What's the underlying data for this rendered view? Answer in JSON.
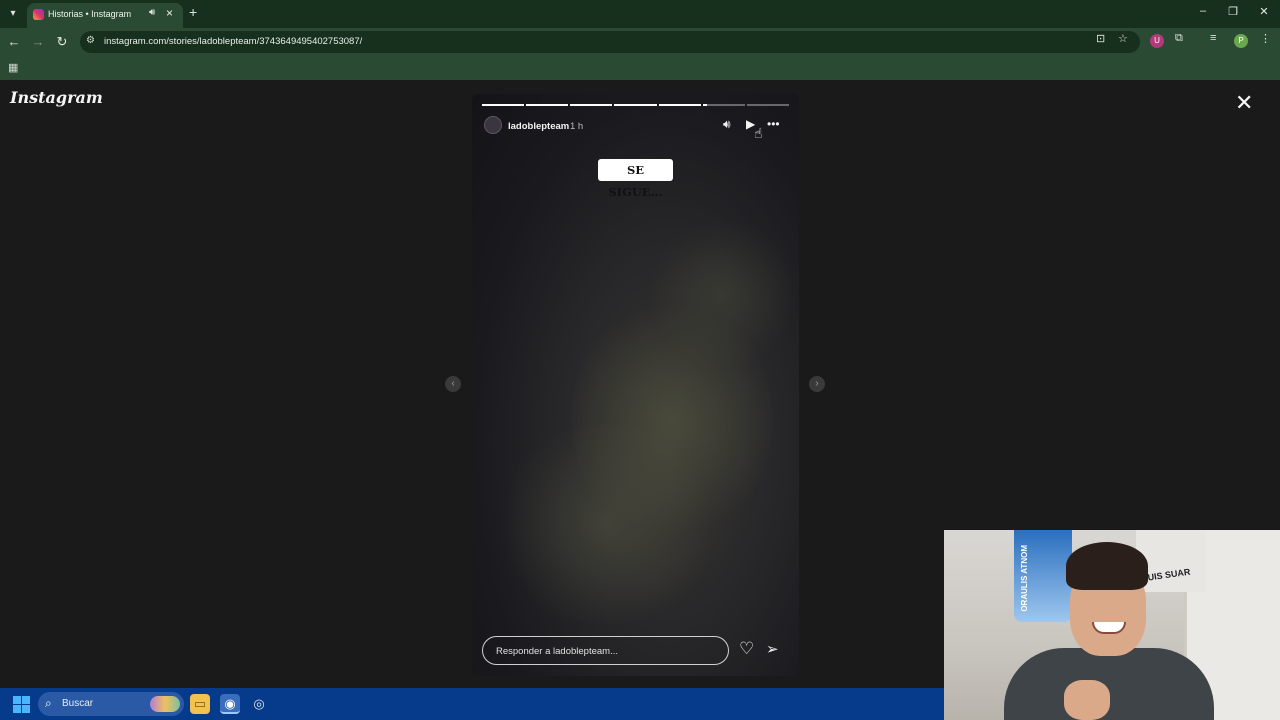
{
  "browser": {
    "tab_title": "Historias • Instagram",
    "url": "instagram.com/stories/ladoblepteam/3743649495402753087/",
    "profile_initial": "P",
    "ext_initial": "U"
  },
  "instagram": {
    "logo": "Instagram",
    "story": {
      "username": "ladoblepteam",
      "time": "1 h",
      "sticker_text": "SE SIGUE...",
      "reply_placeholder": "Responder a ladoblepteam...",
      "progress": [
        1,
        1,
        1,
        1,
        1,
        0.1,
        0
      ]
    }
  },
  "taskbar": {
    "search_placeholder": "Buscar"
  },
  "webcam": {
    "jersey_text": "ORAULIS ATNOM",
    "poster_text": "LUIS SUAR"
  },
  "colors": {
    "titlebar": "#17301d",
    "toolbar": "#2b4a33",
    "page_bg": "#1a1a1a",
    "taskbar": "#063a8a"
  }
}
